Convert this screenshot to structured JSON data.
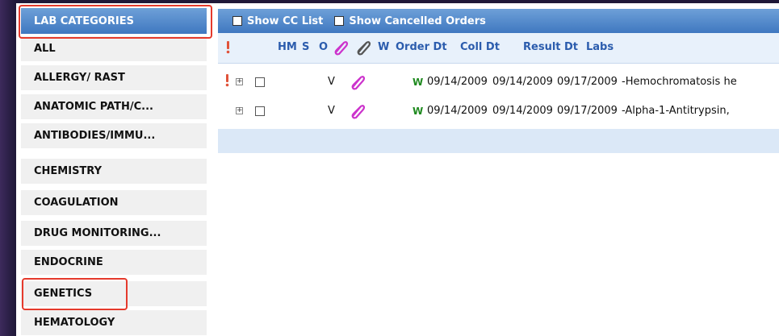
{
  "sidebar": {
    "header": "LAB CATEGORIES",
    "items": [
      {
        "label": "ALL"
      },
      {
        "label": "ALLERGY/ RAST"
      },
      {
        "label": "ANATOMIC PATH/C..."
      },
      {
        "label": "ANTIBODIES/IMMU..."
      },
      {
        "label": "CHEMISTRY"
      },
      {
        "label": "COAGULATION"
      },
      {
        "label": "DRUG MONITORING..."
      },
      {
        "label": "ENDOCRINE"
      },
      {
        "label": "GENETICS"
      },
      {
        "label": "HEMATOLOGY"
      }
    ]
  },
  "toolbar": {
    "show_cc_list": "Show CC List",
    "show_cancelled_orders": "Show Cancelled Orders"
  },
  "grid": {
    "columns": {
      "hm": "HM",
      "s": "S",
      "o": "O",
      "w": "W",
      "order_dt": "Order Dt",
      "coll_dt": "Coll Dt",
      "result_dt": "Result Dt",
      "labs": "Labs"
    },
    "rows": [
      {
        "s": "V",
        "w": "W",
        "order_dt": "09/14/2009",
        "coll_dt": "09/14/2009",
        "result_dt": "09/17/2009",
        "labs": "-Hemochromatosis he",
        "alert": true
      },
      {
        "s": "V",
        "w": "W",
        "order_dt": "09/14/2009",
        "coll_dt": "09/14/2009",
        "result_dt": "09/17/2009",
        "labs": "-Alpha-1-Antitrypsin,",
        "alert": false
      }
    ]
  },
  "colors": {
    "header_blue": "#3f78c0",
    "highlight_red": "#e53a2c",
    "column_text": "#2b5cad",
    "w_green": "#1f8a1f",
    "clip_magenta": "#cc33cc"
  },
  "icons": [
    "exclamation-icon",
    "expand-plus-icon",
    "paperclip-icon",
    "paperclip-gray-icon"
  ]
}
